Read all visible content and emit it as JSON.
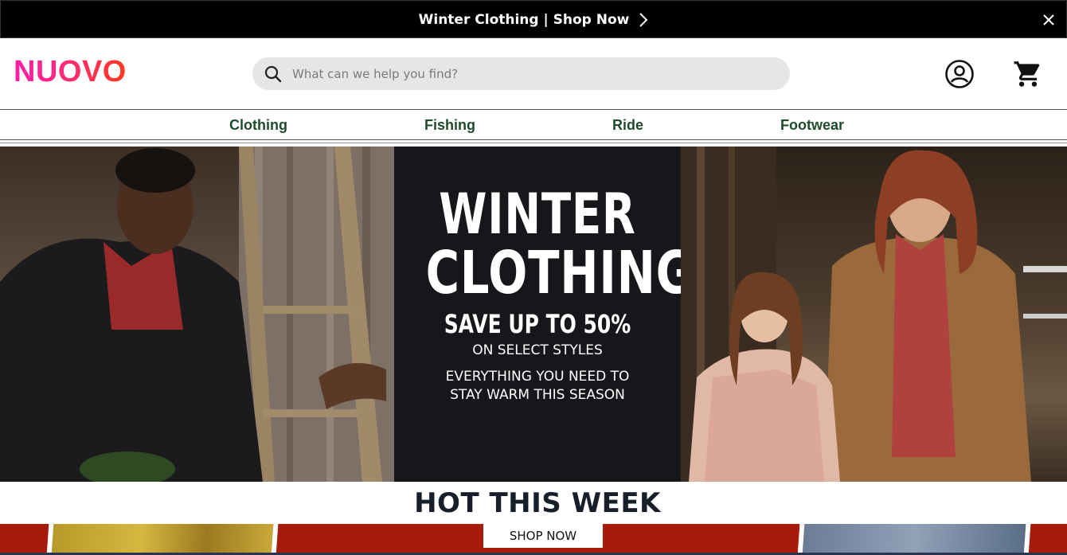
{
  "announcement": {
    "text": "Winter Clothing | Shop Now",
    "chevron_icon": "chevron-right-icon",
    "close_icon": "close-icon"
  },
  "header": {
    "logo": "NUOVO",
    "search": {
      "placeholder": "What can we help you find?",
      "value": ""
    },
    "account_icon": "account-icon",
    "cart_icon": "cart-icon"
  },
  "nav": {
    "items": [
      {
        "label": "Clothing"
      },
      {
        "label": "Fishing"
      },
      {
        "label": "Ride"
      },
      {
        "label": "Footwear"
      }
    ]
  },
  "hero": {
    "line1": "WINTER",
    "line2": "CLOTHING",
    "line3": "SAVE UP TO 50%",
    "line4": "ON SELECT STYLES",
    "line5a": "EVERYTHING YOU NEED TO",
    "line5b": "STAY WARM THIS SEASON"
  },
  "hot": {
    "title": "HOT THIS WEEK",
    "cta": "SHOP NOW"
  },
  "colors": {
    "announcement_bg": "#000000",
    "nav_text": "#1f4a2c",
    "promo_red": "#a81b0b",
    "hero_panel": "#17161b"
  }
}
